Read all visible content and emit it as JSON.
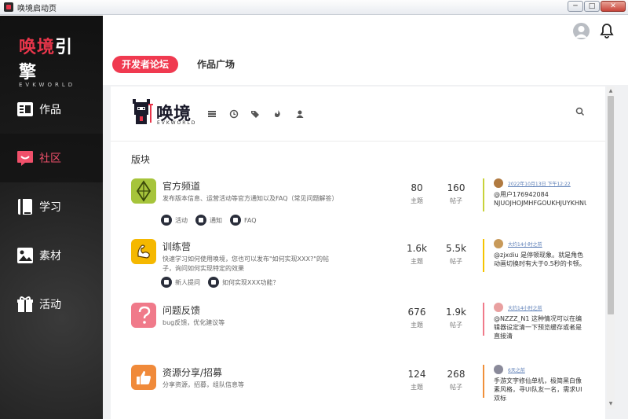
{
  "window": {
    "title": "唤境启动页",
    "buttons": {
      "minimize": "─",
      "maximize": "□",
      "close": "✕"
    }
  },
  "sidebar": {
    "logo_main_a": "唤境",
    "logo_main_b": "引擎",
    "logo_sub": "EVKWORLD",
    "items": [
      {
        "label": "作品",
        "icon": "works-icon",
        "active": false
      },
      {
        "label": "社区",
        "icon": "community-icon",
        "active": true
      },
      {
        "label": "学习",
        "icon": "book-icon",
        "active": false
      },
      {
        "label": "素材",
        "icon": "image-icon",
        "active": false
      },
      {
        "label": "活动",
        "icon": "gift-icon",
        "active": false
      }
    ]
  },
  "tabs": [
    {
      "label": "开发者论坛",
      "active": true
    },
    {
      "label": "作品广场",
      "active": false
    }
  ],
  "forum": {
    "logo_cn": "唤境",
    "logo_en": "EVKWORLD",
    "section_title": "版块",
    "topics_label": "主题",
    "posts_label": "帖子",
    "categories": [
      {
        "name": "官方频道",
        "desc": "发布版本信息、运营活动等官方通知以及FAQ（常见问题解答）",
        "icon_color": "#a6c43b",
        "accent": "#c8d23a",
        "subs": [
          "活动",
          "通知",
          "FAQ"
        ],
        "topics": "80",
        "posts": "160",
        "latest_time": "2022年10月13日 下午12:22",
        "latest_text": "@用户176942084 NJUOJHOJMHFGOUKHJUYKHNUI"
      },
      {
        "name": "训练营",
        "desc": "快速学习如何使用唤境，您也可以发布\"如何实现XXX?\"的帖子，询问如何实现特定的效果",
        "icon_color": "#f5b800",
        "accent": "#f5c400",
        "subs": [
          "新人提问",
          "如何实现XXX功能？"
        ],
        "topics": "1.6k",
        "posts": "5.5k",
        "latest_time": "大约14小时之前",
        "latest_text": "@zjxdiu 是停顿现象。就是角色动画切换时有大于0.5秒的卡顿。"
      },
      {
        "name": "问题反馈",
        "desc": "bug反馈，优化建议等",
        "icon_color": "#f07a8a",
        "accent": "#f07a8a",
        "subs": [],
        "topics": "676",
        "posts": "1.9k",
        "latest_time": "大约14小时之前",
        "latest_text": "@NZZZ_N1 这种情况可以在编辑器设定清一下预览缓存或者是直接清"
      },
      {
        "name": "资源分享/招募",
        "desc": "分享资源，招募，组队信息等",
        "icon_color": "#f08a3a",
        "accent": "#f0903a",
        "subs": [],
        "topics": "124",
        "posts": "268",
        "latest_time": "6天之前",
        "latest_text": "手游文字修仙单机，极简黑白像素风格，寻UI队友一名，需求UI双标"
      }
    ]
  }
}
